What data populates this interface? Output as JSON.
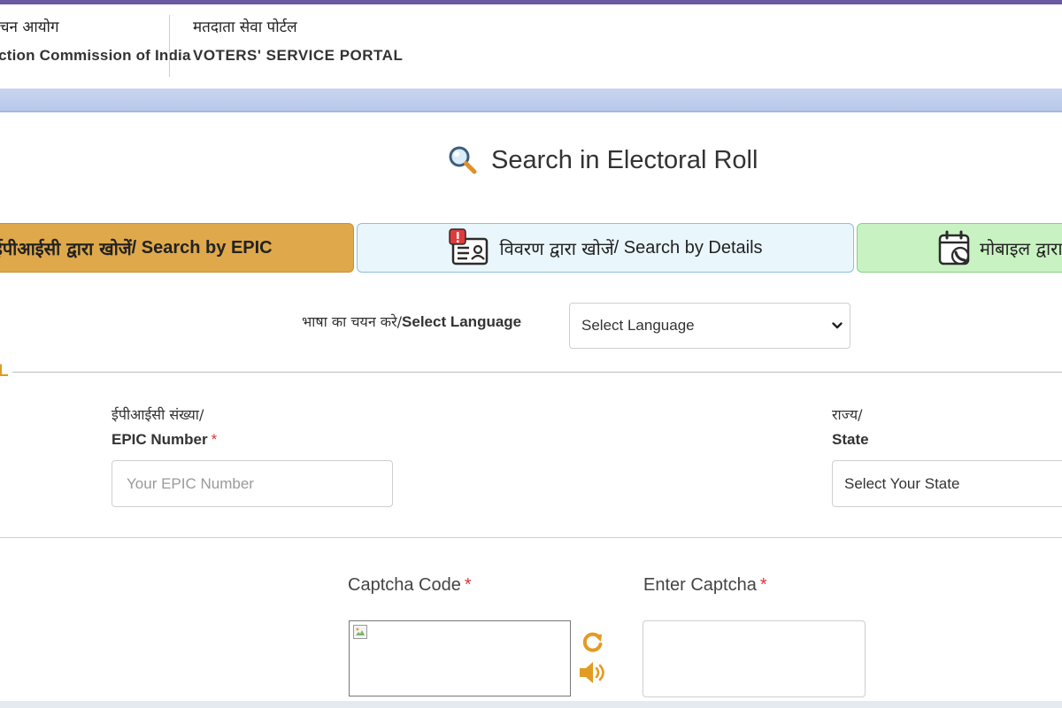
{
  "header": {
    "org_name_hi": "निर्वाचन आयोग",
    "org_name_en": "Election Commission of India",
    "portal_name_hi": "मतदाता सेवा पोर्टल",
    "portal_name_en": "VOTERS' SERVICE PORTAL"
  },
  "page": {
    "title": "Search in Electoral Roll",
    "title_icon": "search-icon"
  },
  "tabs": [
    {
      "label_hi": "ईपीआईसी द्वारा खोजें",
      "label_en": " / Search by EPIC",
      "active": true,
      "color": "#dfa84b"
    },
    {
      "label_hi": "विवरण द्वारा खोजें",
      "label_en": "/ Search by Details",
      "icon": "id-card-alert-icon",
      "color": "#e9f6fb"
    },
    {
      "label_hi": "मोबाइल द्वारा खोजें",
      "label_en": "",
      "icon": "calendar-phone-icon",
      "color": "#c9f2c2"
    }
  ],
  "language": {
    "label_hi": "भाषा का चयन करे/",
    "label_en": "Select Language",
    "selected": "Select Language"
  },
  "form": {
    "legend_fragment": "L",
    "epic": {
      "label_hi": "ईपीआईसी संख्या/",
      "label_en": "EPIC Number",
      "required_mark": "*",
      "placeholder": "Your EPIC Number"
    },
    "state": {
      "label_hi": "राज्य/",
      "label_en": "State",
      "selected": "Select Your State"
    },
    "captcha": {
      "code_label": "Captcha Code",
      "enter_label": "Enter Captcha",
      "required_mark": "*"
    }
  },
  "colors": {
    "accent_orange": "#e09a2a",
    "header_band": "#c9d5f0",
    "required_red": "#d9343a"
  }
}
